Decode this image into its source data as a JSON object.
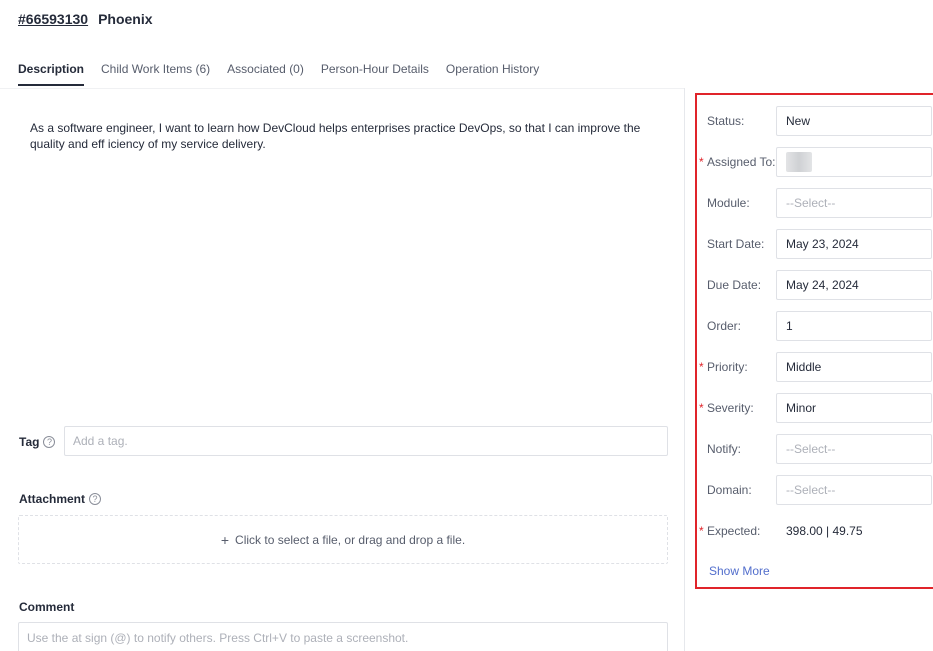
{
  "header": {
    "id": "#66593130",
    "name": "Phoenix"
  },
  "tabs": [
    {
      "label": "Description"
    },
    {
      "label": "Child Work Items (6)"
    },
    {
      "label": "Associated (0)"
    },
    {
      "label": "Person-Hour Details"
    },
    {
      "label": "Operation History"
    }
  ],
  "description": "As a software engineer, I want to learn how DevCloud helps enterprises practice DevOps, so that I can improve the quality and eff iciency of my service delivery.",
  "tag": {
    "label": "Tag",
    "help": "?",
    "placeholder": "Add a tag."
  },
  "attachment": {
    "label": "Attachment",
    "help": "?",
    "plus": "+",
    "dropzone_text": "Click to select a file, or drag and drop a file."
  },
  "comment": {
    "label": "Comment",
    "placeholder": "Use the at sign (@) to notify others. Press Ctrl+V to paste a screenshot."
  },
  "fields": {
    "status": {
      "label": "Status:",
      "value": "New"
    },
    "assigned_to": {
      "required": "*",
      "label": "Assigned To:"
    },
    "module": {
      "label": "Module:",
      "value": "--Select--"
    },
    "start_date": {
      "label": "Start Date:",
      "value": "May 23, 2024"
    },
    "due_date": {
      "label": "Due Date:",
      "value": "May 24, 2024"
    },
    "order": {
      "label": "Order:",
      "value": "1"
    },
    "priority": {
      "required": "*",
      "label": "Priority:",
      "value": "Middle"
    },
    "severity": {
      "required": "*",
      "label": "Severity:",
      "value": "Minor"
    },
    "notify": {
      "label": "Notify:",
      "value": "--Select--"
    },
    "domain": {
      "label": "Domain:",
      "value": "--Select--"
    },
    "expected": {
      "required": "*",
      "label": "Expected:",
      "value": "398.00  |  49.75"
    }
  },
  "show_more": "Show More",
  "colors": {
    "accent_red": "#e0242a",
    "link_blue": "#526ecc"
  }
}
